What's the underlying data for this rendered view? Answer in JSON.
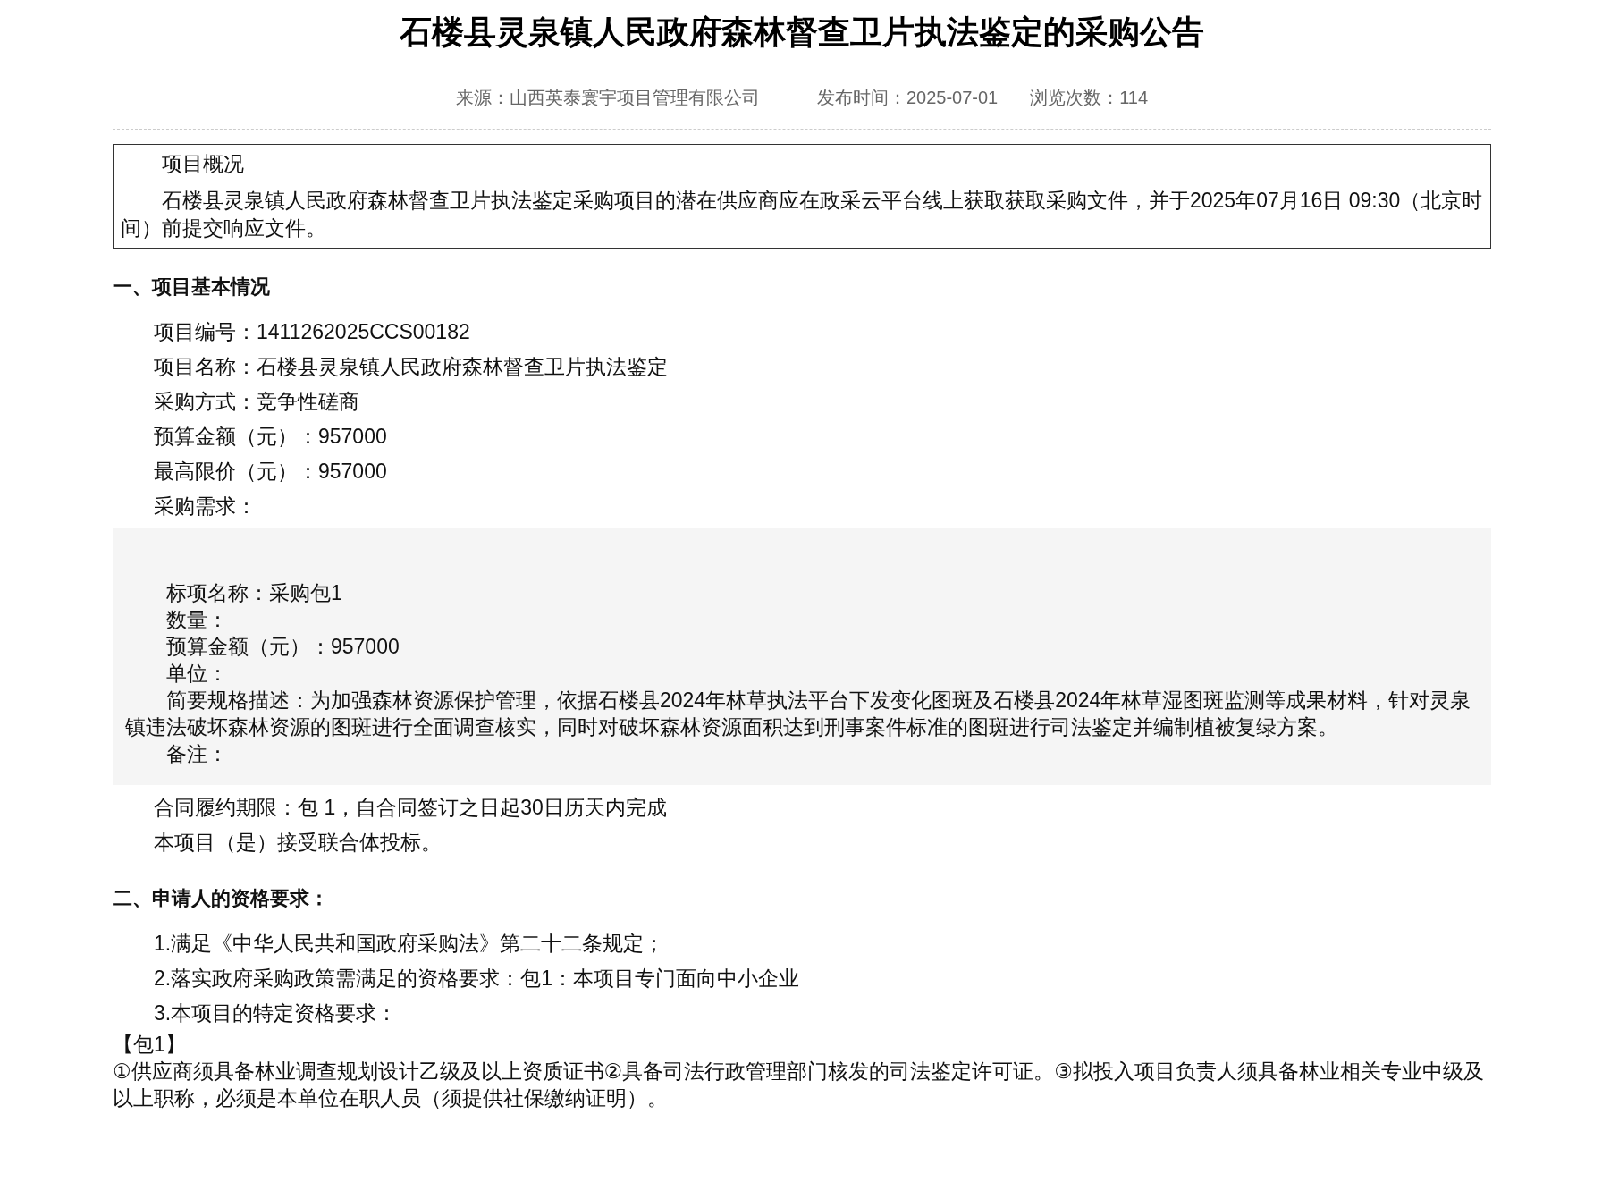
{
  "title": "石楼县灵泉镇人民政府森林督查卫片执法鉴定的采购公告",
  "meta": [
    "来源：山西英泰寰宇项目管理有限公司",
    "发布时间：2025-07-01",
    "浏览次数：114"
  ],
  "overview": {
    "heading": "项目概况",
    "text": "石楼县灵泉镇人民政府森林督查卫片执法鉴定采购项目的潜在供应商应在政采云平台线上获取获取采购文件，并于2025年07月16日 09:30（北京时间）前提交响应文件。"
  },
  "sections": [
    {
      "heading": "一、项目基本情况",
      "blocks": [
        {
          "kind": "line",
          "text": "项目编号：1411262025CCS00182"
        },
        {
          "kind": "line",
          "text": "项目名称：石楼县灵泉镇人民政府森林督查卫片执法鉴定"
        },
        {
          "kind": "line",
          "text": "采购方式：竞争性磋商"
        },
        {
          "kind": "line",
          "text": "预算金额（元）：957000"
        },
        {
          "kind": "line",
          "text": "最高限价（元）：957000"
        },
        {
          "kind": "line",
          "text": "采购需求："
        },
        {
          "kind": "panel",
          "lines": [
            "标项名称：采购包1",
            "数量：",
            "预算金额（元）：957000",
            "单位：",
            "简要规格描述：为加强森林资源保护管理，依据石楼县2024年林草执法平台下发变化图斑及石楼县2024年林草湿图斑监测等成果材料，针对灵泉镇违法破坏森林资源的图斑进行全面调查核实，同时对破坏森林资源面积达到刑事案件标准的图斑进行司法鉴定并编制植被复绿方案。",
            "备注："
          ]
        },
        {
          "kind": "line",
          "text": "合同履约期限：包 1，自合同签订之日起30日历天内完成"
        },
        {
          "kind": "line",
          "text": "本项目（是）接受联合体投标。"
        }
      ]
    },
    {
      "heading": "二、申请人的资格要求：",
      "blocks": [
        {
          "kind": "line",
          "text": "1.满足《中华人民共和国政府采购法》第二十二条规定；"
        },
        {
          "kind": "line",
          "text": "2.落实政府采购政策需满足的资格要求：包1：本项目专门面向中小企业"
        },
        {
          "kind": "line",
          "text": "3.本项目的特定资格要求："
        },
        {
          "kind": "plain",
          "text": "【包1】"
        },
        {
          "kind": "plain",
          "text": "①供应商须具备林业调查规划设计乙级及以上资质证书②具备司法行政管理部门核发的司法鉴定许可证。③拟投入项目负责人须具备林业相关专业中级及以上职称，必须是本单位在职人员（须提供社保缴纳证明）。"
        }
      ]
    }
  ]
}
